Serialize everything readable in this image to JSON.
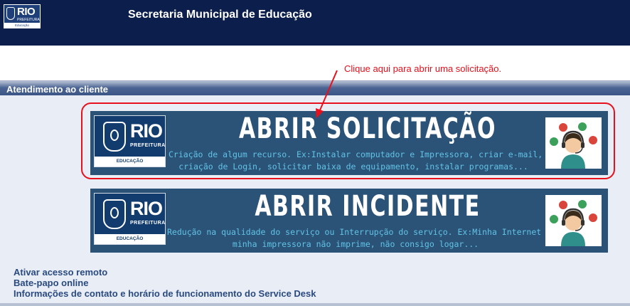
{
  "header": {
    "logo": {
      "brand": "RIO",
      "subtitle": "PREFEITURA",
      "unit": "Educação"
    },
    "site_title": "Secretaria Municipal de Educação",
    "background": "#0c1f4c"
  },
  "annotation": {
    "text": "Clique aqui para abrir uma solicitação.",
    "color": "#e8101c"
  },
  "section": {
    "title": "Atendimento ao cliente"
  },
  "banners": [
    {
      "logo": {
        "brand": "RIO",
        "subtitle": "PREFEITURA",
        "unit": "EDUCAÇÃO"
      },
      "headline": "ABRIR SOLICITAÇÃO",
      "description_line1": "Criação de algum recurso. Ex:Instalar computador e Impressora, criar e-mail,",
      "description_line2": "criação de Login, solicitar baixa de equipamento, instalar programas...",
      "icon": "support-agent-icon"
    },
    {
      "logo": {
        "brand": "RIO",
        "subtitle": "PREFEITURA",
        "unit": "EDUCAÇÃO"
      },
      "headline": "ABRIR INCIDENTE",
      "description_line1": "Redução na qualidade do serviço ou Interrupção do serviço. Ex:Minha Internet parou,",
      "description_line2": "minha impressora não imprime, não consigo logar...",
      "icon": "support-agent-icon"
    }
  ],
  "links": [
    {
      "label": "Ativar acesso remoto"
    },
    {
      "label": "Bate-papo online"
    },
    {
      "label": "Informações de contato e horário de funcionamento do Service Desk"
    }
  ],
  "colors": {
    "banner_bg": "#2b5277",
    "banner_text": "#61c3e6",
    "link": "#2a4a7f",
    "section_bg": "#e9eef6"
  }
}
